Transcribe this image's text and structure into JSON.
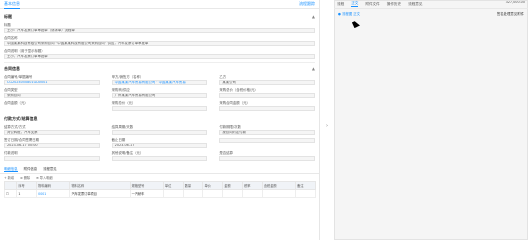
{
  "left": {
    "tab": "基本信息",
    "top_link": "流程跟踪",
    "section1": {
      "title": "标题",
      "collapse": "▲"
    },
    "fields1": [
      {
        "label": "标题",
        "value": "王小：汽车发票订单审批单（请求单）流程单"
      },
      {
        "label": "合同名称",
        "value": "中国某某科技有限公司采购合同 “中国某某科技有限公司采购合同” 供应，汽车发票订单审批单"
      },
      {
        "label": "合同说明（用于显示标题）",
        "value": "王小，汽车发票订单审批单"
      }
    ],
    "section2": {
      "title": "合同信息",
      "collapse": "▲"
    },
    "grid": [
      [
        {
          "label": "合同编号/单据编号",
          "value": "CG2024050801GD0001",
          "blue": true
        },
        {
          "label": "甲方/销售方（名称）",
          "value": "中国某某汽车贸易有限公司 · 中国某某汽车贸易",
          "blue": true
        },
        {
          "label": "乙方",
          "value": "某某公司"
        }
      ],
      [
        {
          "label": "合同类型",
          "value": "采购合同"
        },
        {
          "label": "采购商/供应",
          "value": "广州某某汽车贸易有限公司"
        },
        {
          "label": "采购总价（含税价格/元）",
          "value": ""
        }
      ],
      [
        {
          "label": "合同金额（元）",
          "value": "327,000.00",
          "right": true
        },
        {
          "label": "采购总价（元）",
          "value": ""
        },
        {
          "label": "采购合同金额（元）",
          "value": ""
        }
      ]
    ],
    "section3": {
      "title": "付款方式/结算信息"
    },
    "grid2": [
      [
        {
          "label": "结算方式/方式",
          "value": "对公转账，汽车支票"
        },
        {
          "label": "结算周期/天数",
          "value": ""
        },
        {
          "label": "付款期限/次数",
          "value": "按合同约定付款"
        }
      ],
      [
        {
          "label": "签订日期/合同签署日期",
          "value": "2023-06-17 00:00"
        },
        {
          "label": "截止日期",
          "value": "2023-06-17"
        },
        {
          "label": "",
          "value": ""
        }
      ],
      [
        {
          "label": "付款说明",
          "value": ""
        },
        {
          "label": "其他说明/备注（元）",
          "value": ""
        },
        {
          "label": "是否结算",
          "value": ""
        }
      ]
    ],
    "tabs2": [
      "明细信息",
      "附件信息",
      "流程意见"
    ],
    "tools": [
      "+ 新增",
      "⊗ 删除",
      "⊕ 导入明细"
    ],
    "table": {
      "headers": [
        "",
        "序号",
        "物料编码",
        "物料名称",
        "规格型号",
        "单位",
        "数量",
        "单价",
        "金额",
        "税率",
        "含税金额",
        "备注"
      ],
      "rows": [
        [
          "☐",
          "1",
          "0001",
          "汽车发票订单项目",
          "一汽轿车",
          "",
          "",
          "",
          "",
          "",
          "",
          ""
        ]
      ]
    }
  },
  "right": {
    "tabs": [
      {
        "label": "流程",
        "active": false
      },
      {
        "label": "正文",
        "active": true
      },
      {
        "label": "附件文件",
        "active": false
      },
      {
        "label": "操作历史",
        "active": false
      },
      {
        "label": "流程意见",
        "active": false
      }
    ],
    "row_left": "● 流程图 正文",
    "row_right": "签名处理意见附件"
  },
  "edge_arrow": "›"
}
